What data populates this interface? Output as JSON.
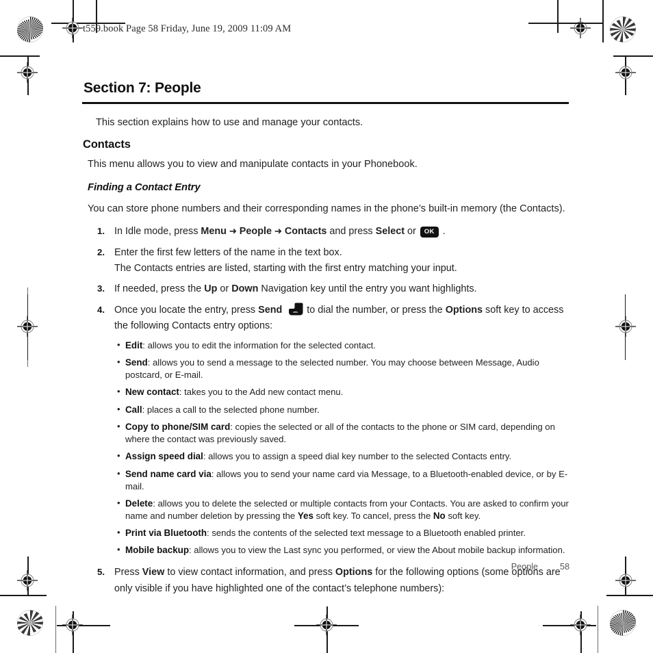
{
  "document": {
    "file_stamp": "t559.book  Page 58  Friday, June 19, 2009  11:09 AM",
    "section_title": "Section 7: People",
    "intro": "This section explains how to use and manage your contacts.",
    "heading_contacts": "Contacts",
    "contacts_intro": "This menu allows you to view and manipulate contacts in your Phonebook.",
    "subheading_finding": "Finding a Contact Entry",
    "finding_intro": "You can store phone numbers and their corresponding names in the phone’s built-in memory (the Contacts)."
  },
  "steps": [
    {
      "num": "1.",
      "parts": [
        {
          "t": "text",
          "v": "In Idle mode, press "
        },
        {
          "t": "bold",
          "v": "Menu"
        },
        {
          "t": "arrow",
          "v": " ➜ "
        },
        {
          "t": "bold",
          "v": "People"
        },
        {
          "t": "arrow",
          "v": " ➜ "
        },
        {
          "t": "bold",
          "v": "Contacts"
        },
        {
          "t": "text",
          "v": " and press "
        },
        {
          "t": "bold",
          "v": "Select"
        },
        {
          "t": "text",
          "v": " or "
        },
        {
          "t": "okkey",
          "v": "OK"
        },
        {
          "t": "text",
          "v": " ."
        }
      ]
    },
    {
      "num": "2.",
      "parts": [
        {
          "t": "text",
          "v": "Enter the first few letters of the name in the text box."
        }
      ],
      "continuation": "The Contacts entries are listed, starting with the first entry matching your input."
    },
    {
      "num": "3.",
      "parts": [
        {
          "t": "text",
          "v": "If needed, press the "
        },
        {
          "t": "bold",
          "v": "Up"
        },
        {
          "t": "text",
          "v": " or "
        },
        {
          "t": "bold",
          "v": "Down"
        },
        {
          "t": "text",
          "v": " Navigation key until the entry you want highlights."
        }
      ]
    },
    {
      "num": "4.",
      "parts": [
        {
          "t": "text",
          "v": "Once you locate the entry, press "
        },
        {
          "t": "bold",
          "v": "Send"
        },
        {
          "t": "sendkey",
          "v": "send-key"
        },
        {
          "t": "text",
          "v": "to dial the number, or press the "
        },
        {
          "t": "bold",
          "v": "Options"
        },
        {
          "t": "text",
          "v": " soft key to access the following Contacts entry options:"
        }
      ]
    }
  ],
  "options_bullets": [
    {
      "term": "Edit",
      "desc": ": allows you to edit the information for the selected contact."
    },
    {
      "term": "Send",
      "desc": ": allows you to send a message to the selected number. You may choose between Message, Audio postcard, or E-mail."
    },
    {
      "term": "New contact",
      "desc": ": takes you to the Add new contact menu."
    },
    {
      "term": "Call",
      "desc": ": places a call to the selected phone number."
    },
    {
      "term": "Copy to phone/SIM card",
      "desc": ": copies the selected or all of the contacts to the phone or SIM card, depending on where the contact was previously saved."
    },
    {
      "term": "Assign speed dial",
      "desc": ": allows you to assign a speed dial key number to the selected Contacts entry."
    },
    {
      "term": "Send name card via",
      "desc": ": allows you to send your name card via Message, to a Bluetooth-enabled device, or by E-mail."
    },
    {
      "term": "Delete",
      "desc": ": allows you to delete the selected or multiple contacts from your Contacts. You are asked to confirm your name and number deletion by pressing the ",
      "bold2": "Yes",
      "desc2": " soft key. To cancel, press the ",
      "bold3": "No",
      "desc3": " soft key."
    },
    {
      "term": "Print via Bluetooth",
      "desc": ": sends the contents of the selected text message to a Bluetooth enabled printer."
    },
    {
      "term": "Mobile backup",
      "desc": ": allows you to view the Last sync you performed, or view the About mobile backup information."
    }
  ],
  "step5": {
    "num": "5.",
    "parts": [
      {
        "t": "text",
        "v": "Press "
      },
      {
        "t": "bold",
        "v": "View"
      },
      {
        "t": "text",
        "v": " to view contact information, and press "
      },
      {
        "t": "bold",
        "v": "Options"
      },
      {
        "t": "text",
        "v": " for the following options (some options are only visible if you have highlighted one of the contact’s telephone numbers):"
      }
    ]
  },
  "footer": {
    "name": "People",
    "page_number": "58"
  },
  "colors": {
    "ink": "#1a1a1a",
    "heading": "#111111",
    "footer_text": "#555555",
    "rule": "#111111"
  },
  "print_marks": {
    "registration_icon": "registration-target-icon",
    "star_icon": "star-density-target-icon"
  }
}
